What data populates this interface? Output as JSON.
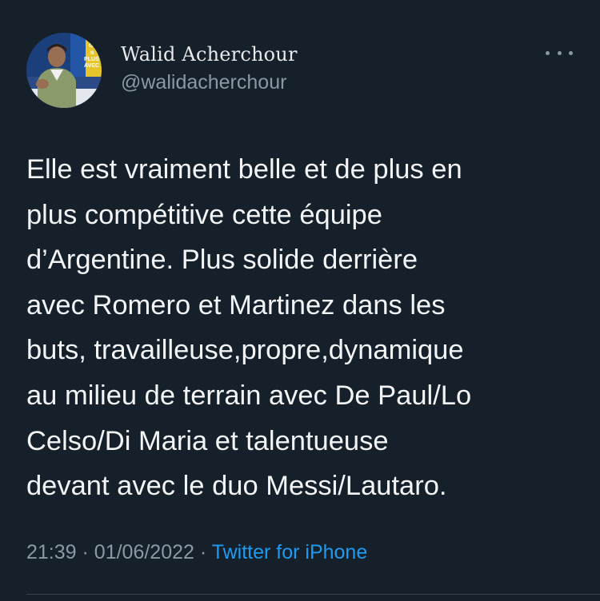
{
  "author": {
    "name": "Walid Acherchour",
    "handle": "@walidacherchour",
    "avatar_sign_text": [
      "G",
      "N",
      "PLUS",
      "AVEC"
    ]
  },
  "more_icon": "more-horizontal-icon",
  "tweet": {
    "lines": [
      "Elle est vraiment belle et de plus en",
      "plus compétitive cette équipe",
      "d’Argentine. Plus solide derrière",
      "avec Romero et Martinez dans les",
      "buts, travailleuse,propre,dynamique",
      "au milieu de terrain avec De Paul/Lo",
      "Celso/Di Maria et talentueuse",
      "devant avec le duo Messi/Lautaro."
    ],
    "time": "21:39",
    "separator": "·",
    "date": "01/06/2022",
    "source": "Twitter for iPhone"
  },
  "colors": {
    "background": "#15202b",
    "text": "#f2f4f5",
    "secondary": "#8b98a5",
    "accent": "#1d9bf0"
  }
}
